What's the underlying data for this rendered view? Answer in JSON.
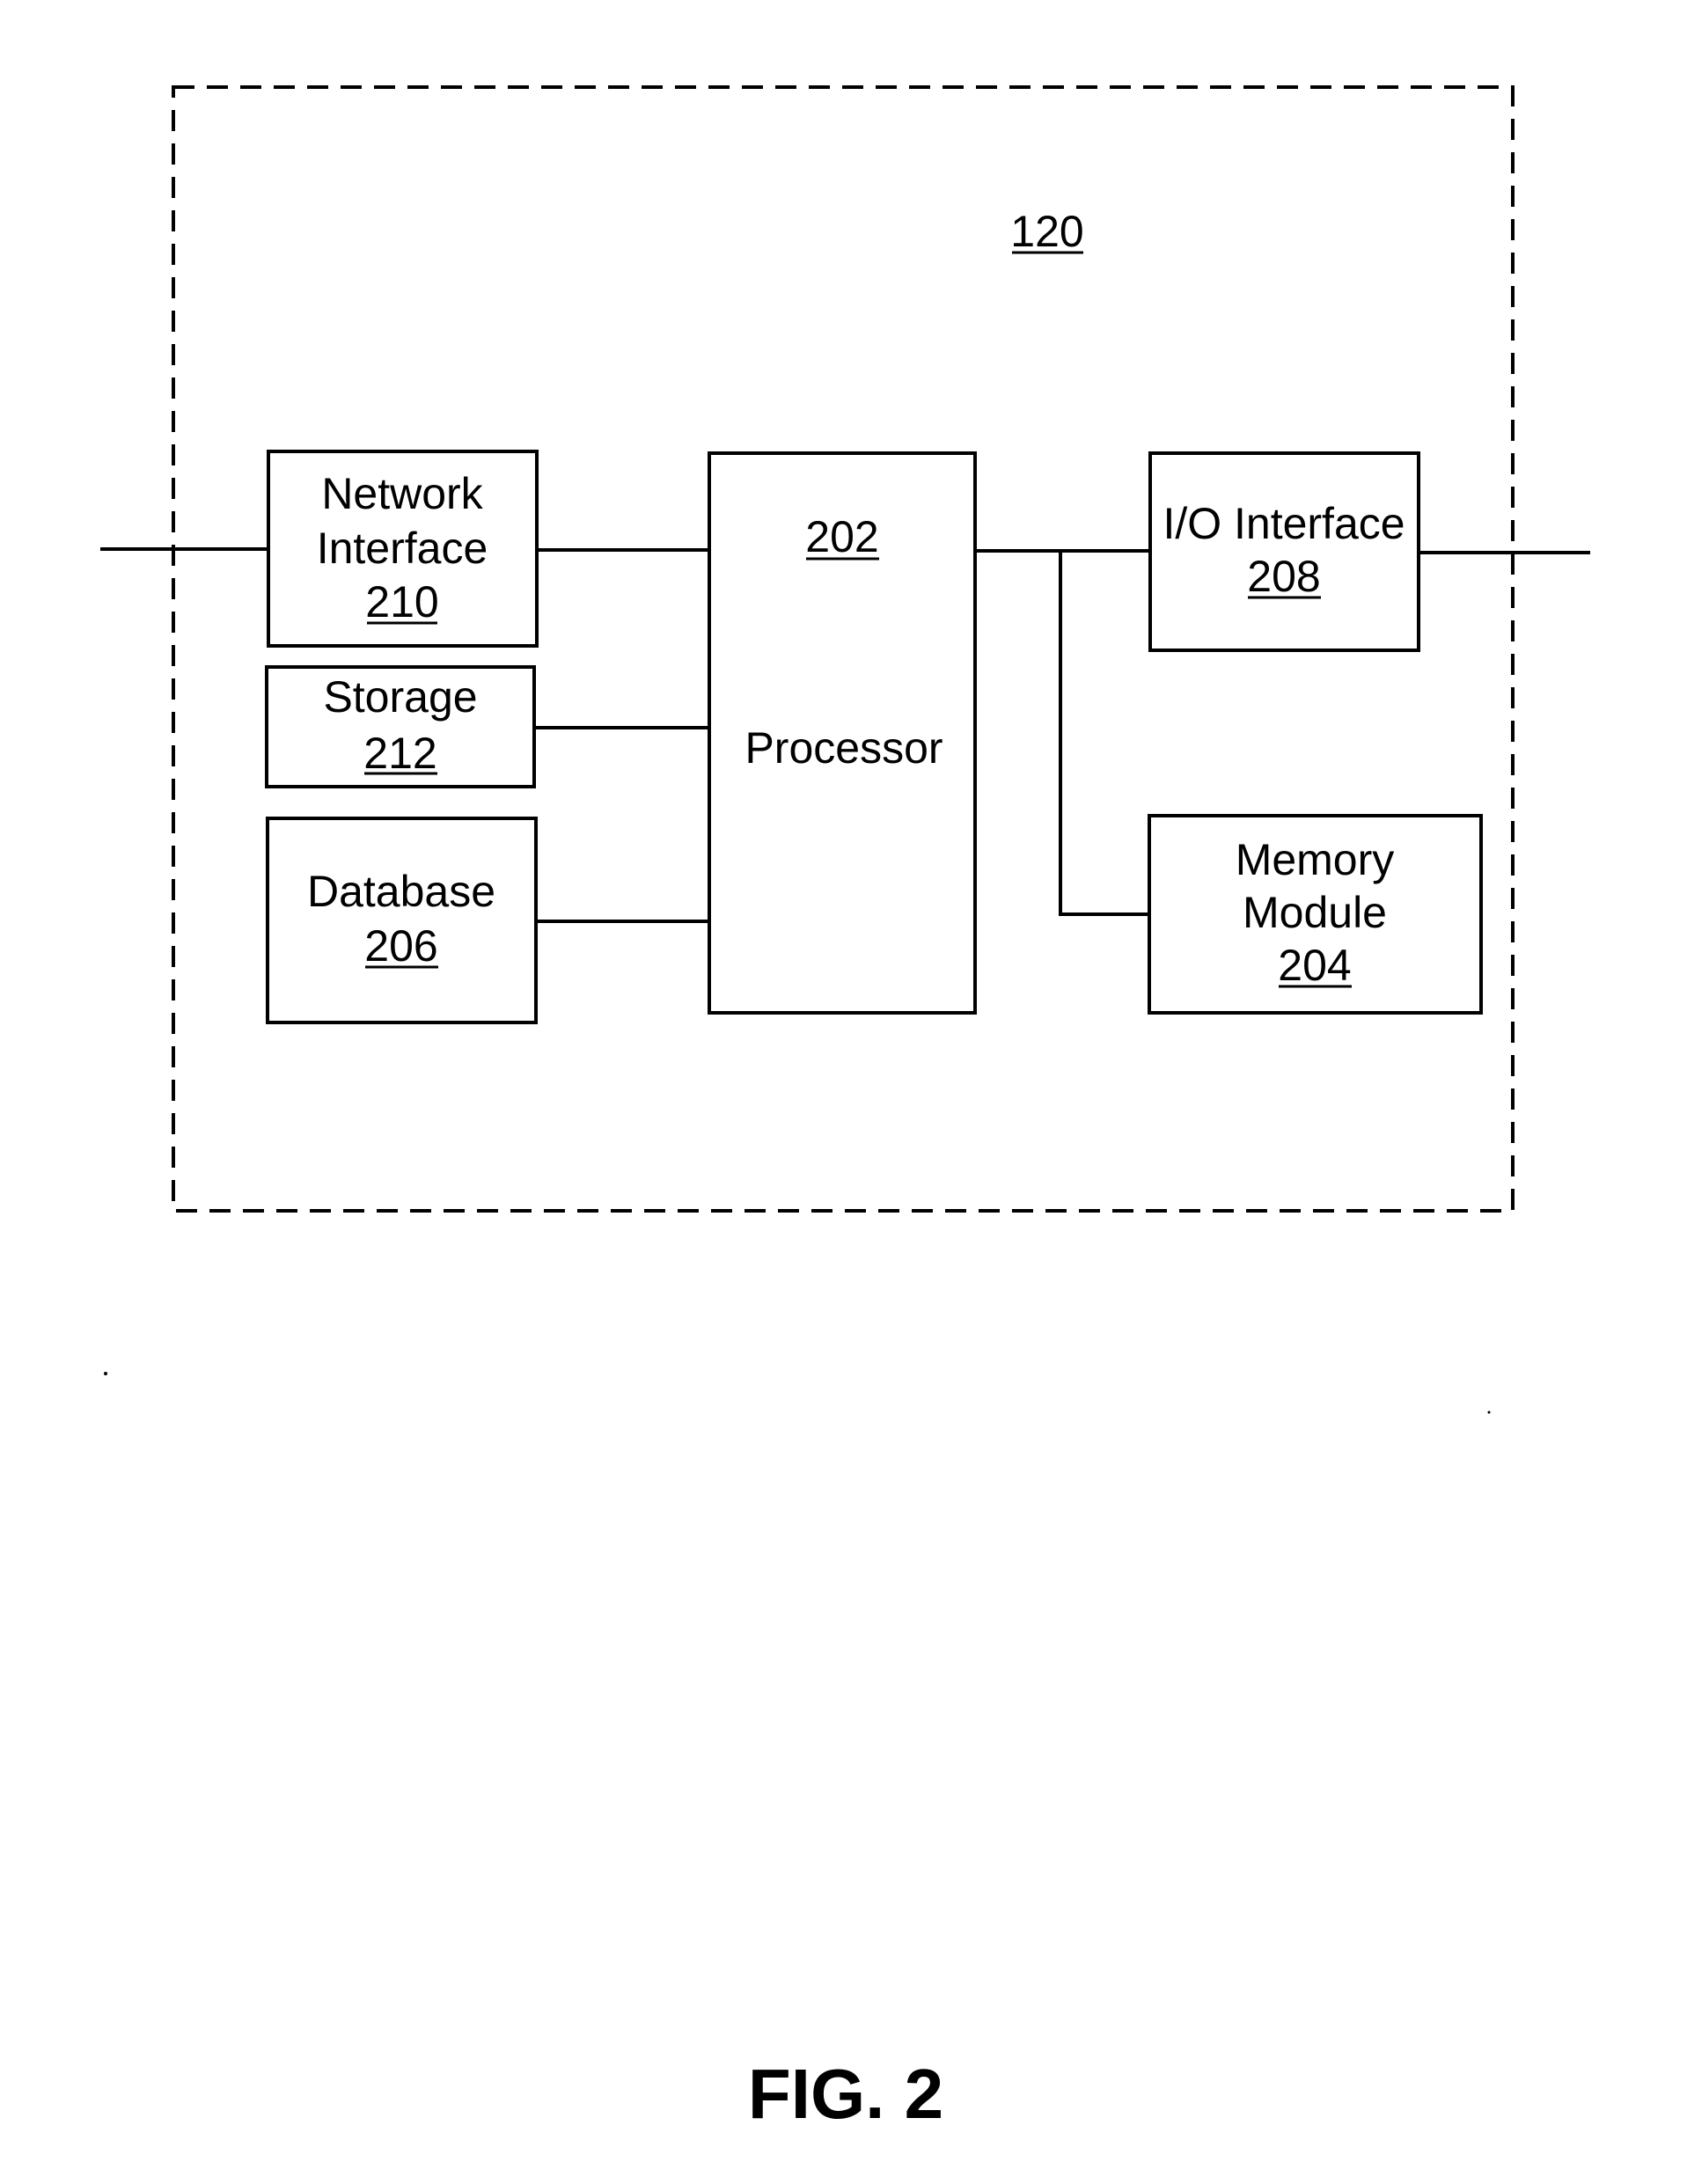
{
  "figure": {
    "caption": "FIG. 2",
    "system": {
      "ref": "120"
    },
    "blocks": {
      "network_interface": {
        "lines": [
          "Network",
          "Interface"
        ],
        "ref": "210"
      },
      "storage": {
        "lines": [
          "Storage"
        ],
        "ref": "212"
      },
      "database": {
        "lines": [
          "Database"
        ],
        "ref": "206"
      },
      "processor": {
        "lines": [
          "Processor"
        ],
        "ref": "202"
      },
      "io_interface": {
        "lines": [
          "I/O Interface"
        ],
        "ref": "208"
      },
      "memory_module": {
        "lines": [
          "Memory",
          "Module"
        ],
        "ref": "204"
      }
    },
    "connections": [
      {
        "from": "external-left",
        "to": "network_interface"
      },
      {
        "from": "network_interface",
        "to": "processor"
      },
      {
        "from": "storage",
        "to": "processor"
      },
      {
        "from": "database",
        "to": "processor"
      },
      {
        "from": "processor",
        "to": "io_interface"
      },
      {
        "from": "processor",
        "to": "memory_module"
      },
      {
        "from": "io_interface",
        "to": "external-right"
      }
    ]
  }
}
